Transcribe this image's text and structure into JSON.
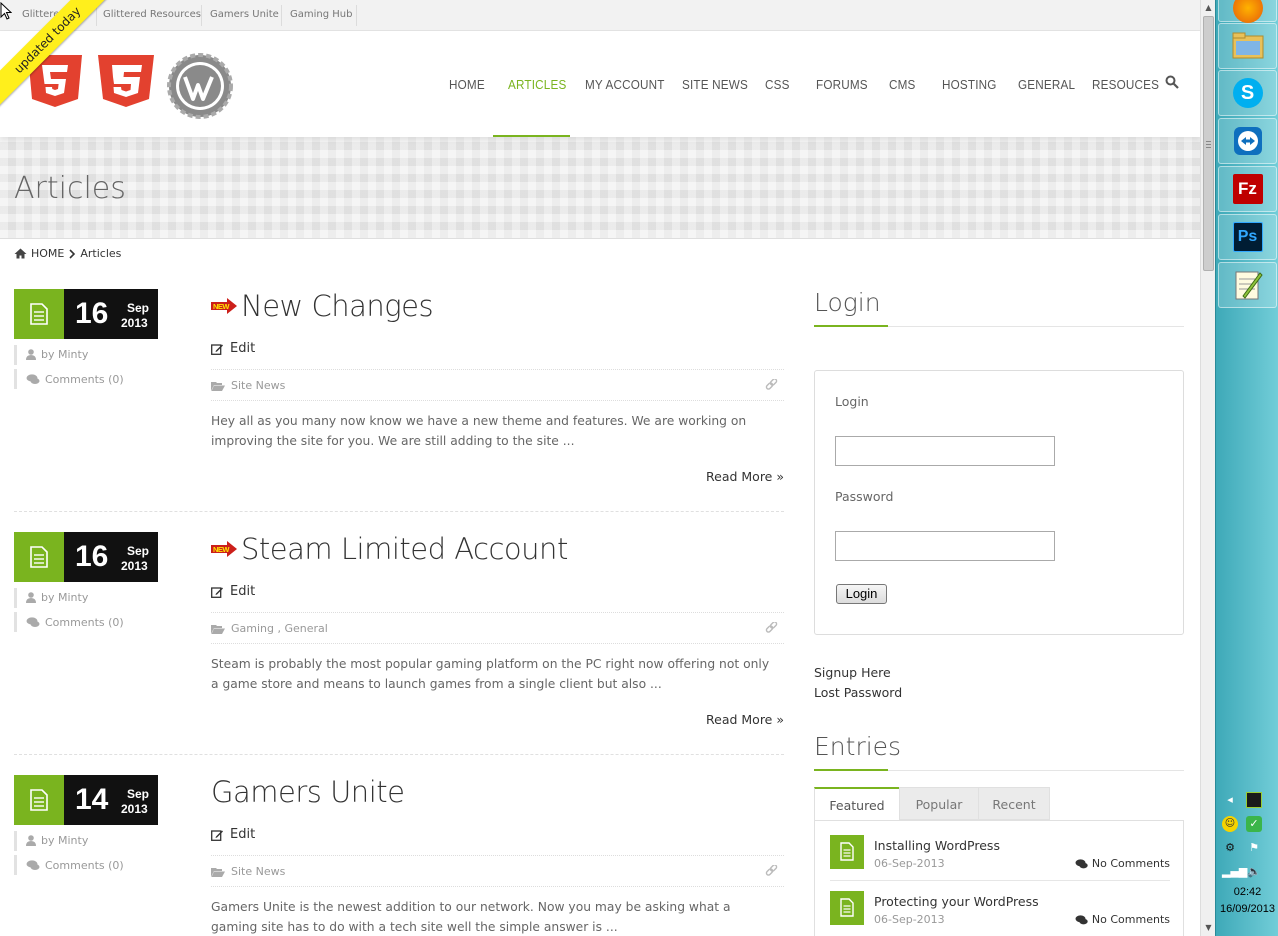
{
  "topbar": {
    "links": [
      "Glittered",
      "Glittered Resources",
      "Gamers Unite",
      "Gaming Hub"
    ]
  },
  "ribbon": {
    "text": "updated today"
  },
  "nav": {
    "items": [
      "HOME",
      "ARTICLES",
      "MY ACCOUNT",
      "SITE NEWS",
      "CSS",
      "FORUMS",
      "CMS",
      "HOSTING",
      "GENERAL",
      "RESOUCES"
    ],
    "active": "ARTICLES",
    "accent": "#7ab41f"
  },
  "page": {
    "title": "Articles"
  },
  "breadcrumb": {
    "home": "HOME",
    "current": "Articles"
  },
  "posts": [
    {
      "day": "16",
      "month": "Sep",
      "year": "2013",
      "author": "by Minty",
      "comments": "Comments (0)",
      "new_badge": "NEW",
      "title": "New Changes",
      "edit": "Edit",
      "categories": "Site News",
      "excerpt": "Hey all as you many now know we have a new theme and features. We are working on improving the site for you. We are still adding to the site ...",
      "read_more": "Read More »"
    },
    {
      "day": "16",
      "month": "Sep",
      "year": "2013",
      "author": "by Minty",
      "comments": "Comments (0)",
      "new_badge": "NEW",
      "title": "Steam Limited Account",
      "edit": "Edit",
      "categories": "Gaming , General",
      "excerpt": "Steam is probably the most popular gaming platform on the PC right now offering not only a game store and means to launch games from a single client but also ...",
      "read_more": "Read More »"
    },
    {
      "day": "14",
      "month": "Sep",
      "year": "2013",
      "author": "by Minty",
      "comments": "Comments (0)",
      "title": "Gamers Unite",
      "edit": "Edit",
      "categories": "Site News",
      "excerpt": "Gamers Unite is the newest addition to our network. Now you may be asking what a gaming site has to do with a tech site well the simple answer is ..."
    }
  ],
  "login_widget": {
    "title": "Login",
    "login_label": "Login",
    "login_value": "",
    "password_label": "Password",
    "password_value": "",
    "button": "Login",
    "signup": "Signup Here",
    "lost_password": "Lost Password"
  },
  "entries_widget": {
    "title": "Entries",
    "tabs": [
      "Featured",
      "Popular",
      "Recent"
    ],
    "active_tab": "Featured",
    "items": [
      {
        "title": "Installing WordPress",
        "date": "06-Sep-2013",
        "comments": "No Comments"
      },
      {
        "title": "Protecting your WordPress",
        "date": "06-Sep-2013",
        "comments": "No Comments"
      }
    ]
  },
  "taskbar": {
    "apps": [
      "firefox-icon",
      "file-explorer-icon",
      "skype-icon",
      "teamviewer-icon",
      "filezilla-icon",
      "photoshop-icon",
      "notepad-plus-plus-icon"
    ],
    "filezilla_label": "Fz",
    "photoshop_label": "Ps",
    "skype_label": "S",
    "clock_time": "02:42",
    "clock_date": "16/09/2013"
  }
}
